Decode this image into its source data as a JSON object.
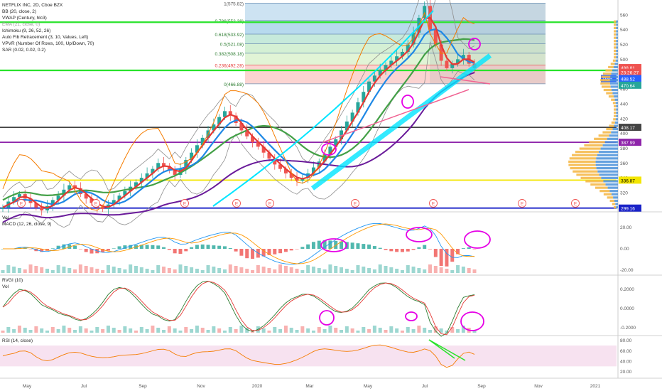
{
  "chart_data": {
    "type": "candlestick",
    "symbol": "NETFLIX INC, 2D, Cboe BZX",
    "indicators": [
      "BB (20, close, 2)",
      "VWAP (Century, hlc3)",
      "EMA (21, close, 0)",
      "Ichimoku (9, 26, 52, 26)",
      "Auto Fib Retracement (3, 10, Values, Left)",
      "VPVR (Number Of Rows, 100, Up/Down, 70)",
      "SAR (0.02, 0.02, 0.2)"
    ],
    "x_labels": [
      "May",
      "Jul",
      "Sep",
      "Nov",
      "2020",
      "Mar",
      "May",
      "Jul",
      "Sep",
      "Nov",
      "2021"
    ],
    "price_axis": [
      560,
      540,
      520,
      500,
      480,
      460,
      440,
      420,
      400,
      380,
      360,
      340,
      320,
      300
    ],
    "ylim": [
      296,
      580
    ],
    "fib_levels": [
      {
        "ratio": "1",
        "label": "1(575.82)",
        "price": 575.82
      },
      {
        "ratio": "0.786",
        "label": "0.786(552.38)",
        "price": 552.38
      },
      {
        "ratio": "0.618",
        "label": "0.618(533.92)",
        "price": 533.92
      },
      {
        "ratio": "0.5",
        "label": "0.5(521.08)",
        "price": 521.08
      },
      {
        "ratio": "0.382",
        "label": "0.382(508.18)",
        "price": 508.18
      },
      {
        "ratio": "0.236",
        "label": "0.236(492.28)",
        "price": 492.28
      },
      {
        "ratio": "0",
        "label": "0(466.88)",
        "price": 466.88
      }
    ],
    "horizontal_levels": [
      {
        "price": 408.17,
        "label": "408.17",
        "color": "#444444"
      },
      {
        "price": 387.99,
        "label": "387.99",
        "color": "#8e24aa"
      },
      {
        "price": 336.87,
        "label": "336.87",
        "color": "#f3e600"
      },
      {
        "price": 299.16,
        "label": "299.16",
        "color": "#1a23c8"
      },
      {
        "price": 550,
        "label": "",
        "color": "#29e32b"
      },
      {
        "price": 485,
        "label": "",
        "color": "#29e32b"
      }
    ],
    "price_tags": [
      {
        "label": "488.81",
        "price": 488.8,
        "color": "#ef5350"
      },
      {
        "label": "23:26:27",
        "price": 482.5,
        "color": "#ef5350"
      },
      {
        "label": "Post",
        "price": 474,
        "color": "#2962ff"
      },
      {
        "label": "488.52",
        "price": 474,
        "color": "#2962ff"
      },
      {
        "label": "470.64",
        "price": 465,
        "color": "#26a69a"
      }
    ],
    "close": [
      300,
      308,
      314,
      318,
      312,
      306,
      300,
      296,
      302,
      310,
      316,
      324,
      330,
      326,
      318,
      312,
      306,
      300,
      298,
      304,
      310,
      316,
      322,
      328,
      334,
      340,
      346,
      352,
      360,
      356,
      350,
      344,
      352,
      364,
      374,
      384,
      394,
      404,
      412,
      422,
      430,
      424,
      414,
      404,
      396,
      388,
      382,
      374,
      366,
      358,
      352,
      346,
      340,
      336,
      340,
      346,
      354,
      362,
      372,
      382,
      392,
      404,
      416,
      428,
      442,
      456,
      470,
      478,
      486,
      492,
      498,
      504,
      510,
      520,
      536,
      556,
      572,
      540,
      520,
      498,
      488,
      494,
      500,
      506,
      494,
      488
    ],
    "earnings_marks": [
      "E",
      "E",
      "E",
      "E",
      "E",
      "E",
      "E",
      "E",
      "E"
    ],
    "panes": {
      "vol_label": "Vol",
      "macd": {
        "label": "MACD (12, 26, close, 9)",
        "ticks": [
          "20.00",
          "0.00",
          "-20.00"
        ]
      },
      "rvgi": {
        "label": "RVGI (10)",
        "sub": "Vol",
        "ticks": [
          "0.2000",
          "0.0000",
          "-0.2000"
        ]
      },
      "rsi": {
        "label": "RSI (14, close)",
        "ticks": [
          "80.00",
          "60.00",
          "40.00",
          "20.00"
        ]
      }
    },
    "colors": {
      "up": "#26a69a",
      "down": "#ef5350",
      "bb": "#8e8e8e",
      "ema": "#e53935",
      "vwap": "#1e88e5",
      "annotation": "#e600e6",
      "trend": "#00e5ff",
      "rsi": "#f57c00"
    }
  }
}
